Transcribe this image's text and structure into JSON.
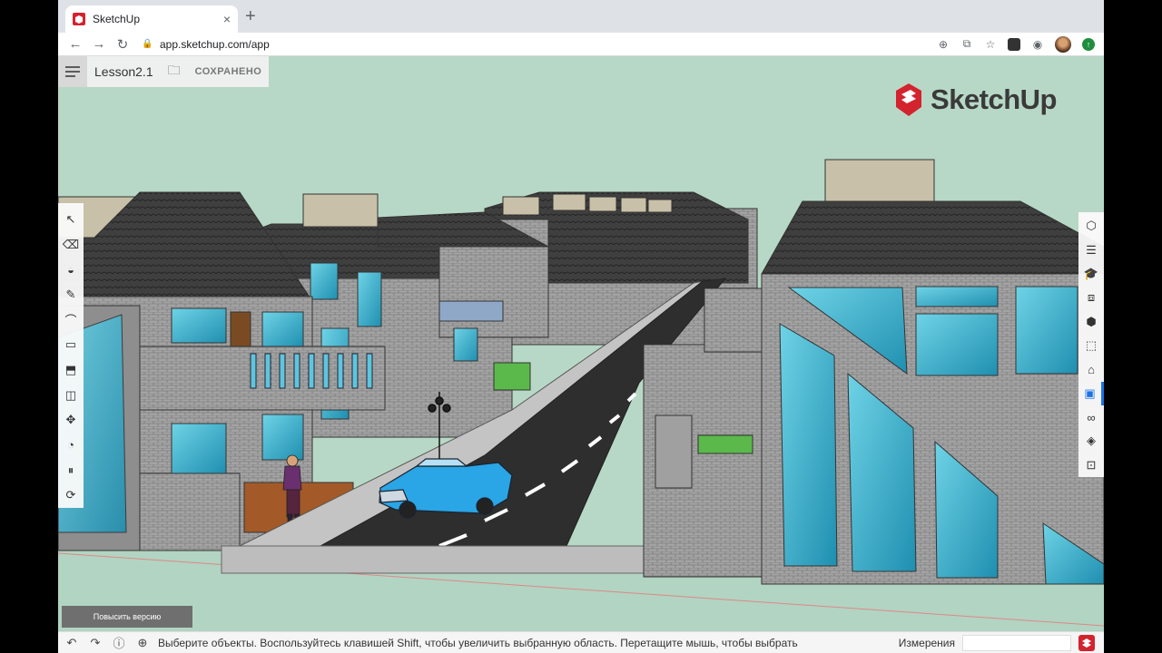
{
  "browser": {
    "tab_title": "SketchUp",
    "tab_close": "×",
    "new_tab": "+",
    "url": "app.sketchup.com/app"
  },
  "toolbar": {
    "file_name": "Lesson2.1",
    "save_status": "СОХРАНЕНО"
  },
  "logo": {
    "text": "SketchUp"
  },
  "upgrade_button": "Повысить версию",
  "status": {
    "hint": "Выберите объекты. Воспользуйтесь клавишей Shift, чтобы увеличить выбранную область. Перетащите мышь, чтобы выбрать",
    "measurements_label": "Измерения"
  },
  "left_tools": [
    "select-tool",
    "eraser-tool",
    "paint-bucket-tool",
    "pencil-tool",
    "arc-tool",
    "rectangle-tool",
    "push-pull-tool",
    "offset-tool",
    "move-tool",
    "tape-measure-tool",
    "walk-tool",
    "orbit-tool"
  ],
  "right_tools": [
    "entity-info-icon",
    "instructor-icon",
    "components-icon",
    "materials-icon",
    "styles-icon",
    "outliner-icon",
    "tags-icon",
    "scenes-icon",
    "display-icon",
    "shadows-icon",
    "solar-icon"
  ],
  "colors": {
    "sky": "#b7d8c6",
    "brick": "#9a9a9a",
    "glass": "#34b6d1",
    "car": "#2aa5e6",
    "brand": "#d3232f"
  }
}
